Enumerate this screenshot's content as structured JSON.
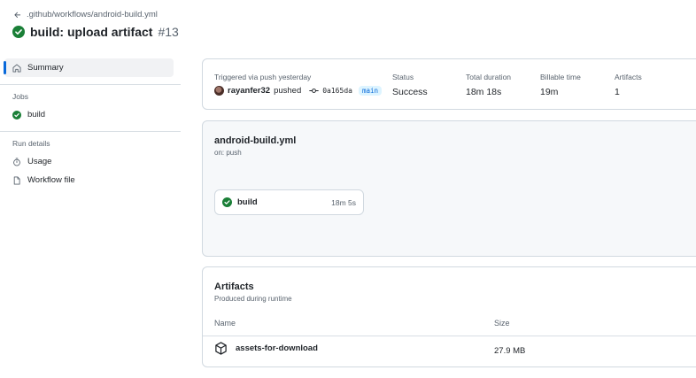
{
  "header": {
    "back_path": ".github/workflows/android-build.yml",
    "run_title": "build: upload artifact",
    "run_number": "#13"
  },
  "sidebar": {
    "summary_label": "Summary",
    "jobs_heading": "Jobs",
    "job_label": "build",
    "run_details_heading": "Run details",
    "usage_label": "Usage",
    "workflow_file_label": "Workflow file"
  },
  "summary": {
    "triggered_label": "Triggered via push yesterday",
    "actor": "rayanfer32",
    "action": "pushed",
    "commit": "0a165da",
    "branch": "main",
    "status_label": "Status",
    "status_value": "Success",
    "duration_label": "Total duration",
    "duration_value": "18m 18s",
    "billable_label": "Billable time",
    "billable_value": "19m",
    "artifacts_label": "Artifacts",
    "artifacts_value": "1"
  },
  "workflow": {
    "name": "android-build.yml",
    "trigger": "on: push",
    "job_name": "build",
    "job_duration": "18m 5s"
  },
  "artifacts": {
    "title": "Artifacts",
    "subtitle": "Produced during runtime",
    "col_name": "Name",
    "col_size": "Size",
    "rows": [
      {
        "name": "assets-for-download",
        "size": "27.9 MB"
      }
    ]
  },
  "colors": {
    "success": "#1a7f37",
    "accent": "#0969da",
    "muted_text": "#59636e",
    "border": "#d1d9e0"
  },
  "icons": {
    "back": "arrow-left-icon",
    "status": "check-circle-fill-icon",
    "summary": "home-icon",
    "usage": "stopwatch-icon",
    "workflow_file": "file-icon",
    "commit": "git-commit-icon",
    "artifact": "package-icon"
  }
}
